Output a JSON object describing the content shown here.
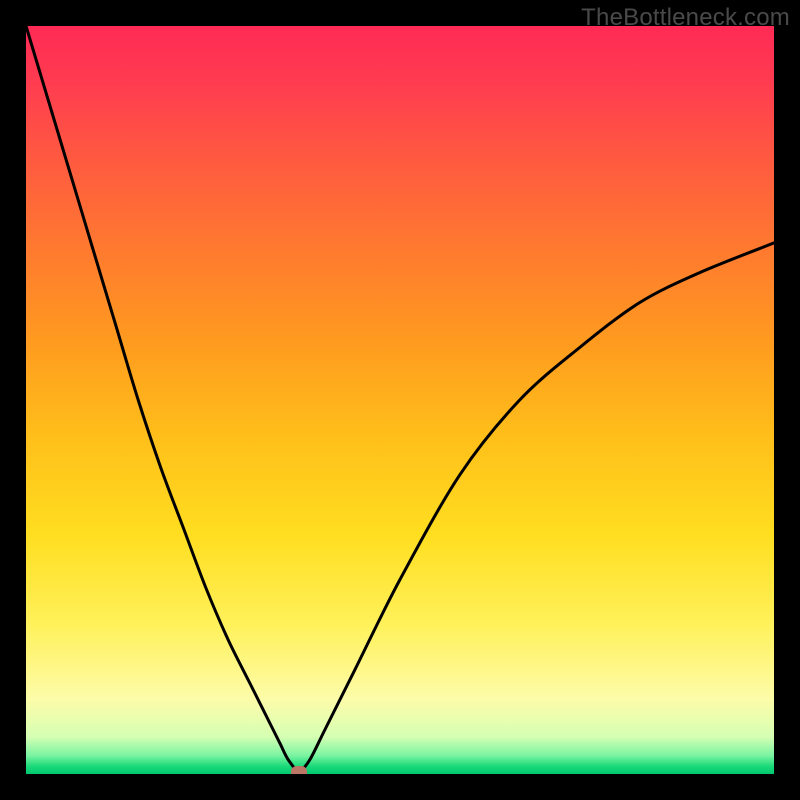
{
  "watermark": "TheBottleneck.com",
  "colors": {
    "frame": "#000000",
    "curve_stroke": "#000000",
    "marker": "#bb7766",
    "gradient_top": "#ff2a55",
    "gradient_bottom": "#00c870"
  },
  "chart_data": {
    "type": "line",
    "title": "",
    "xlabel": "",
    "ylabel": "",
    "xlim": [
      0,
      100
    ],
    "ylim": [
      0,
      100
    ],
    "grid": false,
    "background": "vertical-rainbow-gradient",
    "series": [
      {
        "name": "bottleneck-curve",
        "x": [
          0,
          3,
          6,
          9,
          12,
          15,
          18,
          21,
          24,
          27,
          30,
          33,
          34,
          35,
          36.5,
          38,
          40,
          44,
          50,
          58,
          66,
          74,
          82,
          90,
          100
        ],
        "y": [
          100,
          90,
          80,
          70,
          60,
          50,
          41,
          33,
          25,
          18,
          12,
          6,
          4,
          2,
          0,
          2,
          6,
          14,
          26,
          40,
          50,
          57,
          63,
          67,
          71
        ]
      }
    ],
    "marker": {
      "name": "optimal-point",
      "x": 36.5,
      "y": 0
    }
  }
}
